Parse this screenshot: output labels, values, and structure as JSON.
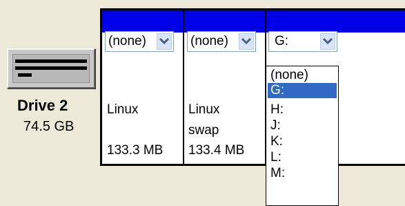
{
  "drive": {
    "name": "Drive 2",
    "size": "74.5 GB",
    "icon": "hard-drive-icon"
  },
  "partitions": [
    {
      "drive_letter": "(none)",
      "type_line1": "Linux",
      "type_line2": "",
      "size": "133.3 MB"
    },
    {
      "drive_letter": "(none)",
      "type_line1": "Linux",
      "type_line2": "swap",
      "size": "133.4 MB"
    },
    {
      "drive_letter": "G:",
      "type_line1": "",
      "type_line2": "",
      "size": ""
    }
  ],
  "dropdown": {
    "options": [
      "(none)",
      "G:",
      "H:",
      "J:",
      "K:",
      "L:",
      "M:"
    ],
    "selected_index": 1
  },
  "colors": {
    "title_bar": "#0000e8",
    "selection": "#316ac5",
    "combo_button": "#d7e4fa",
    "background": "#ece9d8"
  }
}
